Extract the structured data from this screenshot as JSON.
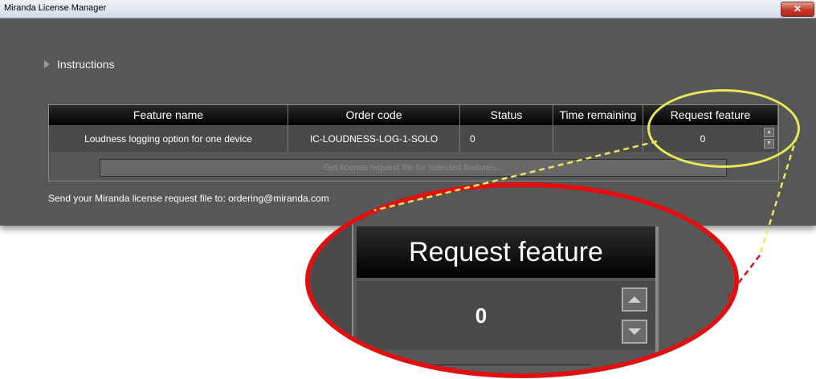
{
  "window": {
    "title": "Miranda License Manager",
    "close_label": "✕"
  },
  "instructions": {
    "label": "Instructions",
    "icon": "triangle-right-icon"
  },
  "table": {
    "columns": [
      "Feature name",
      "Order code",
      "Status",
      "Time remaining",
      "Request feature"
    ],
    "rows": [
      {
        "feature_name": "Loudness logging option for one device",
        "order_code": "IC-LOUDNESS-LOG-1-SOLO",
        "status": "0",
        "time_remaining": "",
        "request_feature": "0"
      }
    ]
  },
  "get_license_button": {
    "label": "Get license request file for selected features..."
  },
  "send_text": "Send your Miranda license request file to: ordering@miranda.com",
  "zoom": {
    "header": "Request feature",
    "value": "0"
  },
  "colors": {
    "window_bg": "#575757",
    "header_bg": "#000000",
    "highlight": "#e8e85a",
    "zoom_ring": "#e01010"
  }
}
